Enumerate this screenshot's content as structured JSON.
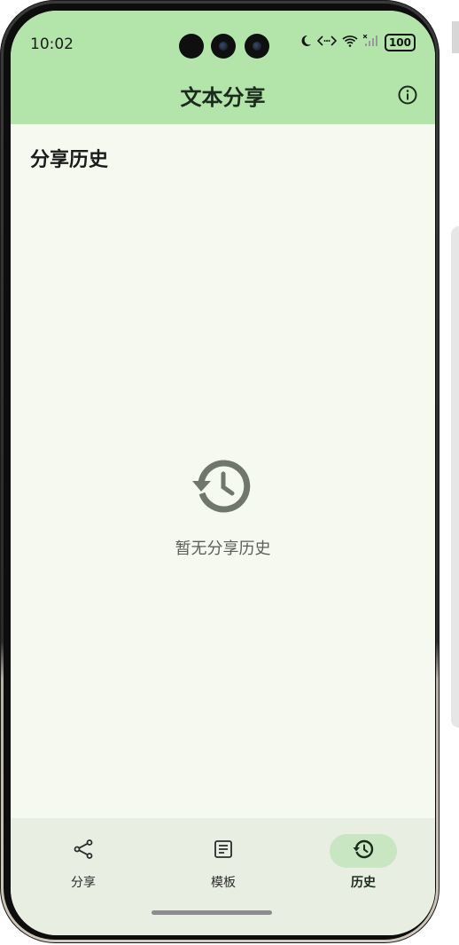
{
  "status_bar": {
    "time": "10:02",
    "battery": "100"
  },
  "app_bar": {
    "title": "文本分享",
    "info_icon": "info-icon"
  },
  "content": {
    "section_title": "分享历史",
    "empty_icon": "history-icon",
    "empty_text": "暂无分享历史"
  },
  "bottom_nav": {
    "items": [
      {
        "label": "分享",
        "icon": "share-icon",
        "active": false
      },
      {
        "label": "模板",
        "icon": "template-icon",
        "active": false
      },
      {
        "label": "历史",
        "icon": "history-icon",
        "active": true
      }
    ]
  },
  "colors": {
    "header_bg": "#b3e5ab",
    "screen_bg": "#f6f9ef",
    "nav_bg": "#e9eee2",
    "nav_active_bg": "#c8e6c2",
    "empty_icon": "#6f776c"
  }
}
